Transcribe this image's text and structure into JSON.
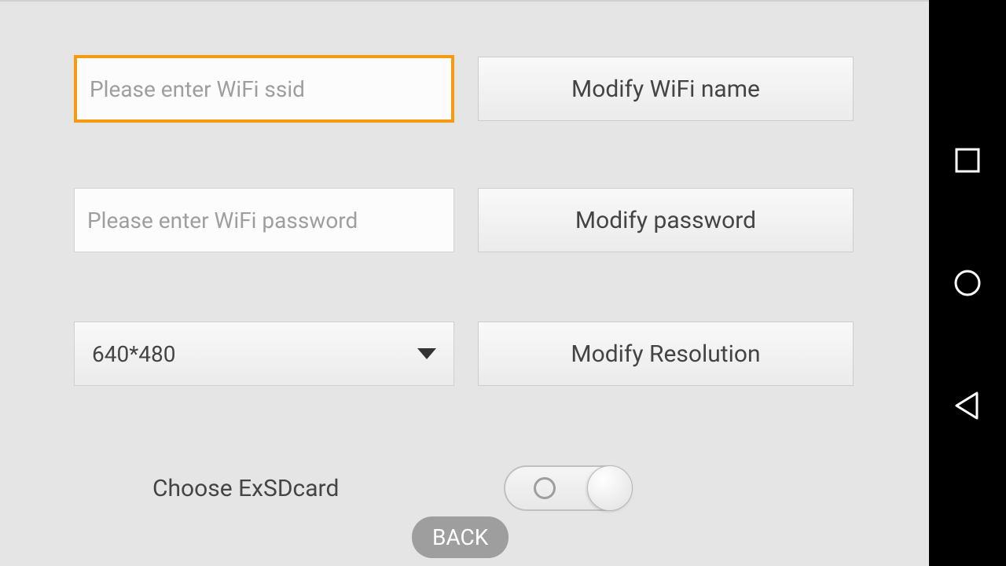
{
  "inputs": {
    "ssid": {
      "placeholder": "Please enter WiFi ssid",
      "value": ""
    },
    "password": {
      "placeholder": "Please enter WiFi password",
      "value": ""
    }
  },
  "dropdown": {
    "resolution": {
      "selected": "640*480"
    }
  },
  "buttons": {
    "modify_wifi_name": "Modify WiFi name",
    "modify_password": "Modify password",
    "modify_resolution": "Modify Resolution",
    "back": "BACK"
  },
  "toggle": {
    "label": "Choose ExSDcard",
    "state": "off"
  }
}
